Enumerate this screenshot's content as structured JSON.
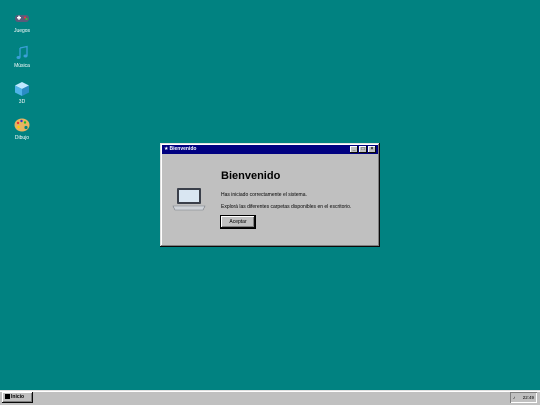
{
  "desktop": {
    "icons": [
      {
        "label": "Juegos",
        "icon": "gamepad-icon"
      },
      {
        "label": "Música",
        "icon": "music-note-icon"
      },
      {
        "label": "3D",
        "icon": "cube-icon"
      },
      {
        "label": "Dibujo",
        "icon": "palette-icon"
      }
    ]
  },
  "window": {
    "title_icon": "★",
    "title": "Bienvenido",
    "heading": "Bienvenido",
    "line1": "Has iniciado correctamente el sistema.",
    "line2": "Explorá las diferentes carpetas disponibles en el escritorio.",
    "accept_label": "Aceptar",
    "minimize_label": "_",
    "maximize_label": "□",
    "close_label": "×"
  },
  "taskbar": {
    "start_label": "Inicio",
    "speaker": "♪",
    "clock": "22:49"
  },
  "colors": {
    "desktop": "#018281",
    "titlebar": "#000080",
    "chrome": "#c0c0c0"
  }
}
